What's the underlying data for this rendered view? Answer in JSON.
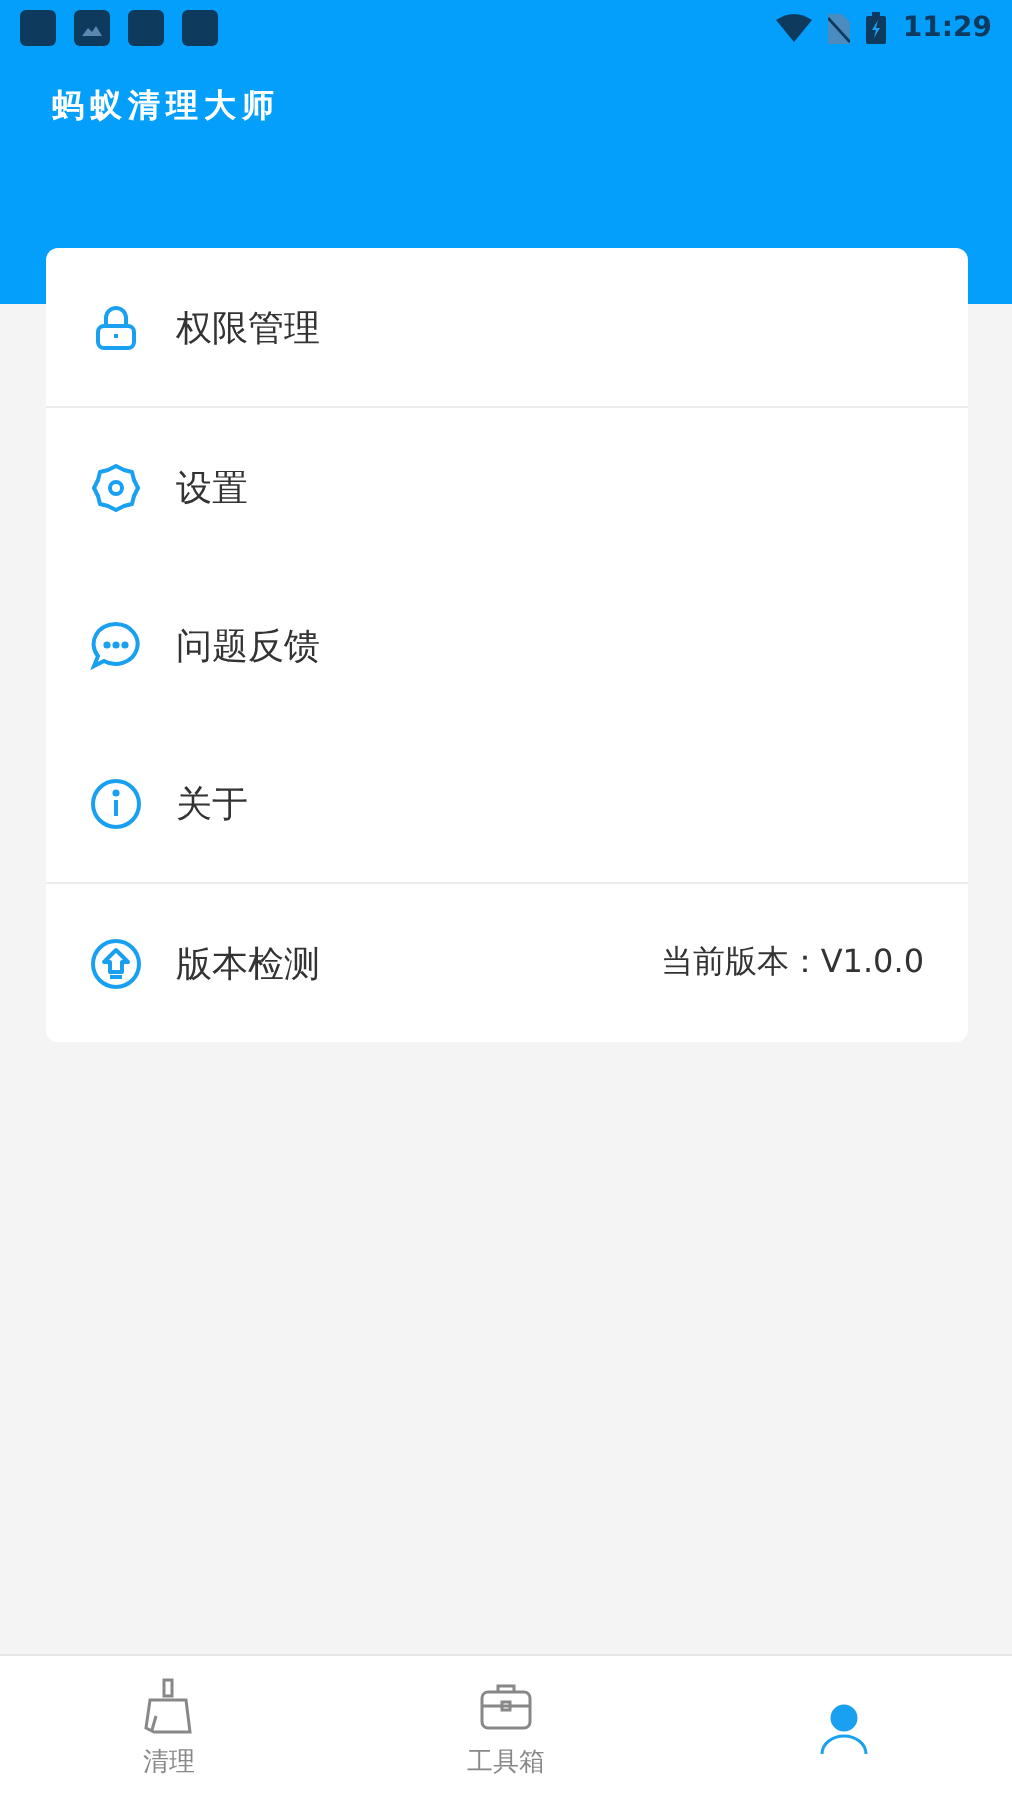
{
  "status_bar": {
    "time": "11:29"
  },
  "header": {
    "title": "蚂蚁清理大师"
  },
  "menu_groups": [
    [
      {
        "kind": "lock",
        "label": "权限管理"
      }
    ],
    [
      {
        "kind": "gear",
        "label": "设置"
      },
      {
        "kind": "chat",
        "label": "问题反馈"
      },
      {
        "kind": "info",
        "label": "关于"
      }
    ],
    [
      {
        "kind": "upgrade",
        "label": "版本检测",
        "value": "当前版本：V1.0.0"
      }
    ]
  ],
  "tabs": [
    {
      "kind": "broom",
      "label": "清理",
      "selected": false
    },
    {
      "kind": "toolbox",
      "label": "工具箱",
      "selected": false
    },
    {
      "kind": "person",
      "selected": true
    }
  ]
}
